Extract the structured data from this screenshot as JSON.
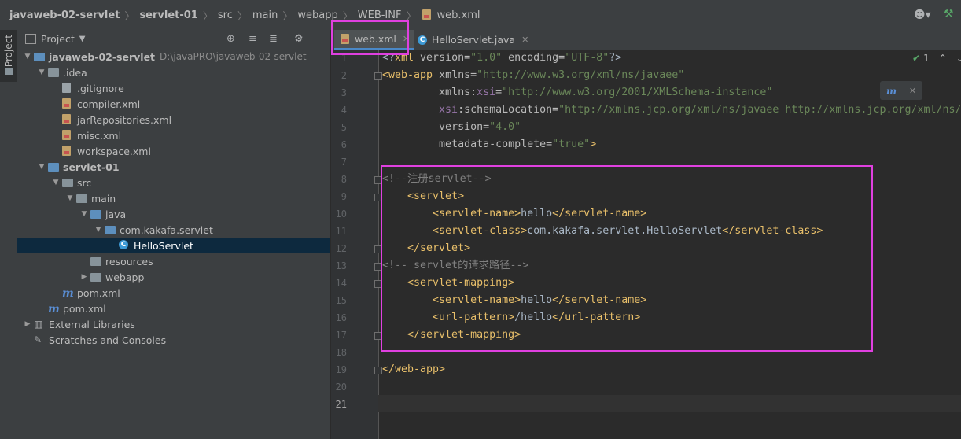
{
  "breadcrumb": [
    {
      "label": "javaweb-02-servlet",
      "bold": true
    },
    {
      "label": "servlet-01",
      "bold": true
    },
    {
      "label": "src"
    },
    {
      "label": "main"
    },
    {
      "label": "webapp"
    },
    {
      "label": "WEB-INF"
    },
    {
      "label": "web.xml"
    }
  ],
  "tool_strip": {
    "project_label": "Project"
  },
  "project_panel": {
    "title": "Project"
  },
  "tree": [
    {
      "label": "javaweb-02-servlet",
      "path": "D:\\javaPRO\\javaweb-02-servlet",
      "depth": 0,
      "arrow": "down",
      "icon": "module-folder-icon",
      "bold": true
    },
    {
      "label": ".idea",
      "depth": 1,
      "arrow": "down",
      "icon": "folder-icon"
    },
    {
      "label": ".gitignore",
      "depth": 2,
      "arrow": "",
      "icon": "gitignore-file-icon"
    },
    {
      "label": "compiler.xml",
      "depth": 2,
      "arrow": "",
      "icon": "xml-file-icon"
    },
    {
      "label": "jarRepositories.xml",
      "depth": 2,
      "arrow": "",
      "icon": "xml-file-icon"
    },
    {
      "label": "misc.xml",
      "depth": 2,
      "arrow": "",
      "icon": "xml-file-icon"
    },
    {
      "label": "workspace.xml",
      "depth": 2,
      "arrow": "",
      "icon": "xml-file-icon"
    },
    {
      "label": "servlet-01",
      "depth": 1,
      "arrow": "down",
      "icon": "module-folder-icon",
      "bold": true
    },
    {
      "label": "src",
      "depth": 2,
      "arrow": "down",
      "icon": "folder-icon"
    },
    {
      "label": "main",
      "depth": 3,
      "arrow": "down",
      "icon": "folder-icon"
    },
    {
      "label": "java",
      "depth": 4,
      "arrow": "down",
      "icon": "source-folder-icon"
    },
    {
      "label": "com.kakafa.servlet",
      "depth": 5,
      "arrow": "down",
      "icon": "package-icon"
    },
    {
      "label": "HelloServlet",
      "depth": 6,
      "arrow": "",
      "icon": "class-icon",
      "selected": true
    },
    {
      "label": "resources",
      "depth": 4,
      "arrow": "",
      "icon": "resources-folder-icon"
    },
    {
      "label": "webapp",
      "depth": 4,
      "arrow": "right",
      "icon": "folder-icon"
    },
    {
      "label": "pom.xml",
      "depth": 2,
      "arrow": "",
      "icon": "maven-icon"
    },
    {
      "label": "pom.xml",
      "depth": 1,
      "arrow": "",
      "icon": "maven-icon"
    },
    {
      "label": "External Libraries",
      "depth": 0,
      "arrow": "right",
      "icon": "libraries-icon"
    },
    {
      "label": "Scratches and Consoles",
      "depth": 0,
      "arrow": "",
      "icon": "scratches-icon"
    }
  ],
  "tabs": [
    {
      "label": "web.xml",
      "icon": "xml-file-icon",
      "active": true
    },
    {
      "label": "HelloServlet.java",
      "icon": "class-icon",
      "active": false
    }
  ],
  "editor": {
    "inspection_count": "1",
    "current_line": 21,
    "lines": [
      {
        "n": 1,
        "tokens": [
          [
            "t-txt",
            "<?"
          ],
          [
            "t-tag",
            "xml "
          ],
          [
            "t-attr",
            "version="
          ],
          [
            "t-val",
            "\"1.0\""
          ],
          [
            "t-attr",
            " encoding="
          ],
          [
            "t-val",
            "\"UTF-8\""
          ],
          [
            "t-txt",
            "?>"
          ]
        ]
      },
      {
        "n": 2,
        "tokens": [
          [
            "t-tag",
            "<web-app "
          ],
          [
            "t-attr",
            "xmlns="
          ],
          [
            "t-val",
            "\"http://www.w3.org/xml/ns/javaee\""
          ]
        ]
      },
      {
        "n": 3,
        "tokens": [
          [
            "t-attr",
            "         xmlns:"
          ],
          [
            "t-ns",
            "xsi"
          ],
          [
            "t-attr",
            "="
          ],
          [
            "t-val",
            "\"http://www.w3.org/2001/XMLSchema-instance\""
          ]
        ]
      },
      {
        "n": 4,
        "tokens": [
          [
            "t-ns",
            "         xsi"
          ],
          [
            "t-attr",
            ":schemaLocation="
          ],
          [
            "t-val",
            "\"http://xmlns.jcp.org/xml/ns/javaee http://xmlns.jcp.org/xml/ns/"
          ]
        ]
      },
      {
        "n": 5,
        "tokens": [
          [
            "t-attr",
            "         version="
          ],
          [
            "t-val",
            "\"4.0\""
          ]
        ]
      },
      {
        "n": 6,
        "tokens": [
          [
            "t-attr",
            "         metadata-complete="
          ],
          [
            "t-val",
            "\"true\""
          ],
          [
            "t-tag",
            ">"
          ]
        ]
      },
      {
        "n": 7,
        "tokens": []
      },
      {
        "n": 8,
        "tokens": [
          [
            "t-cmt",
            "<!--注册servlet-->"
          ]
        ]
      },
      {
        "n": 9,
        "tokens": [
          [
            "t-tag",
            "    <servlet>"
          ]
        ]
      },
      {
        "n": 10,
        "tokens": [
          [
            "t-tag",
            "        <servlet-name>"
          ],
          [
            "t-txt",
            "hello"
          ],
          [
            "t-tag",
            "</servlet-name>"
          ]
        ]
      },
      {
        "n": 11,
        "tokens": [
          [
            "t-tag",
            "        <servlet-class>"
          ],
          [
            "t-txt",
            "com.kakafa.servlet.HelloServlet"
          ],
          [
            "t-tag",
            "</servlet-class>"
          ]
        ]
      },
      {
        "n": 12,
        "tokens": [
          [
            "t-tag",
            "    </servlet>"
          ]
        ]
      },
      {
        "n": 13,
        "tokens": [
          [
            "t-cmt",
            "<!-- servlet的请求路径-->"
          ]
        ]
      },
      {
        "n": 14,
        "tokens": [
          [
            "t-tag",
            "    <servlet-mapping>"
          ]
        ]
      },
      {
        "n": 15,
        "tokens": [
          [
            "t-tag",
            "        <servlet-name>"
          ],
          [
            "t-txt",
            "hello"
          ],
          [
            "t-tag",
            "</servlet-name>"
          ]
        ]
      },
      {
        "n": 16,
        "tokens": [
          [
            "t-tag",
            "        <url-pattern>"
          ],
          [
            "t-txt",
            "/hello"
          ],
          [
            "t-tag",
            "</url-pattern>"
          ]
        ]
      },
      {
        "n": 17,
        "tokens": [
          [
            "t-tag",
            "    </servlet-mapping>"
          ]
        ]
      },
      {
        "n": 18,
        "tokens": []
      },
      {
        "n": 19,
        "tokens": [
          [
            "t-tag",
            "</web-app>"
          ]
        ]
      },
      {
        "n": 20,
        "tokens": []
      },
      {
        "n": 21,
        "tokens": []
      }
    ]
  },
  "colors": {
    "highlight": "#e040e0",
    "tag": "#e8bf6a",
    "string": "#6a8759",
    "comment": "#808080"
  }
}
